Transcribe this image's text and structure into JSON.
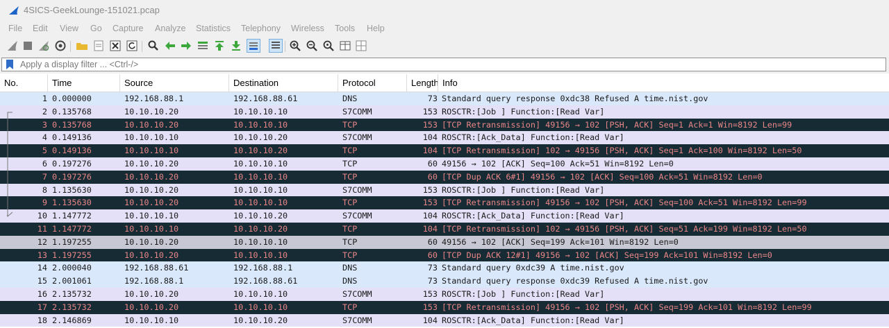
{
  "window": {
    "title": "4SICS-GeekLounge-151021.pcap",
    "logo_icon": "wireshark-fin-icon"
  },
  "menu": [
    "File",
    "Edit",
    "View",
    "Go",
    "Capture",
    "Analyze",
    "Statistics",
    "Telephony",
    "Wireless",
    "Tools",
    "Help"
  ],
  "filter": {
    "placeholder": "Apply a display filter ... <Ctrl-/>",
    "value": ""
  },
  "columns": [
    "No.",
    "Time",
    "Source",
    "Destination",
    "Protocol",
    "Length",
    "Info"
  ],
  "packets": [
    {
      "no": "1",
      "time": "0.000000",
      "src": "192.168.88.1",
      "dst": "192.168.88.61",
      "proto": "DNS",
      "len": "73",
      "info": "Standard query response 0xdc38 Refused A time.nist.gov",
      "style": "light"
    },
    {
      "no": "2",
      "time": "0.135768",
      "src": "10.10.10.20",
      "dst": "10.10.10.10",
      "proto": "S7COMM",
      "len": "153",
      "info": "ROSCTR:[Job     ] Function:[Read Var]",
      "style": "lilac"
    },
    {
      "no": "3",
      "time": "0.135768",
      "src": "10.10.10.20",
      "dst": "10.10.10.10",
      "proto": "TCP",
      "len": "153",
      "info": "[TCP Retransmission] 49156 → 102 [PSH, ACK] Seq=1 Ack=1 Win=8192 Len=99",
      "style": "dark"
    },
    {
      "no": "4",
      "time": "0.149136",
      "src": "10.10.10.10",
      "dst": "10.10.10.20",
      "proto": "S7COMM",
      "len": "104",
      "info": "ROSCTR:[Ack_Data] Function:[Read Var]",
      "style": "lilac"
    },
    {
      "no": "5",
      "time": "0.149136",
      "src": "10.10.10.10",
      "dst": "10.10.10.20",
      "proto": "TCP",
      "len": "104",
      "info": "[TCP Retransmission] 102 → 49156 [PSH, ACK] Seq=1 Ack=100 Win=8192 Len=50",
      "style": "dark"
    },
    {
      "no": "6",
      "time": "0.197276",
      "src": "10.10.10.20",
      "dst": "10.10.10.10",
      "proto": "TCP",
      "len": "60",
      "info": "49156 → 102 [ACK] Seq=100 Ack=51 Win=8192 Len=0",
      "style": "lilac"
    },
    {
      "no": "7",
      "time": "0.197276",
      "src": "10.10.10.20",
      "dst": "10.10.10.10",
      "proto": "TCP",
      "len": "60",
      "info": "[TCP Dup ACK 6#1] 49156 → 102 [ACK] Seq=100 Ack=51 Win=8192 Len=0",
      "style": "dark"
    },
    {
      "no": "8",
      "time": "1.135630",
      "src": "10.10.10.20",
      "dst": "10.10.10.10",
      "proto": "S7COMM",
      "len": "153",
      "info": "ROSCTR:[Job     ] Function:[Read Var]",
      "style": "lilac"
    },
    {
      "no": "9",
      "time": "1.135630",
      "src": "10.10.10.20",
      "dst": "10.10.10.10",
      "proto": "TCP",
      "len": "153",
      "info": "[TCP Retransmission] 49156 → 102 [PSH, ACK] Seq=100 Ack=51 Win=8192 Len=99",
      "style": "dark"
    },
    {
      "no": "10",
      "time": "1.147772",
      "src": "10.10.10.10",
      "dst": "10.10.10.20",
      "proto": "S7COMM",
      "len": "104",
      "info": "ROSCTR:[Ack_Data] Function:[Read Var]",
      "style": "lilac"
    },
    {
      "no": "11",
      "time": "1.147772",
      "src": "10.10.10.10",
      "dst": "10.10.10.20",
      "proto": "TCP",
      "len": "104",
      "info": "[TCP Retransmission] 102 → 49156 [PSH, ACK] Seq=51 Ack=199 Win=8192 Len=50",
      "style": "dark"
    },
    {
      "no": "12",
      "time": "1.197255",
      "src": "10.10.10.20",
      "dst": "10.10.10.10",
      "proto": "TCP",
      "len": "60",
      "info": "49156 → 102 [ACK] Seq=199 Ack=101 Win=8192 Len=0",
      "style": "selected"
    },
    {
      "no": "13",
      "time": "1.197255",
      "src": "10.10.10.20",
      "dst": "10.10.10.10",
      "proto": "TCP",
      "len": "60",
      "info": "[TCP Dup ACK 12#1] 49156 → 102 [ACK] Seq=199 Ack=101 Win=8192 Len=0",
      "style": "dark"
    },
    {
      "no": "14",
      "time": "2.000040",
      "src": "192.168.88.61",
      "dst": "192.168.88.1",
      "proto": "DNS",
      "len": "73",
      "info": "Standard query 0xdc39 A time.nist.gov",
      "style": "light"
    },
    {
      "no": "15",
      "time": "2.001061",
      "src": "192.168.88.1",
      "dst": "192.168.88.61",
      "proto": "DNS",
      "len": "73",
      "info": "Standard query response 0xdc39 Refused A time.nist.gov",
      "style": "light"
    },
    {
      "no": "16",
      "time": "2.135732",
      "src": "10.10.10.20",
      "dst": "10.10.10.10",
      "proto": "S7COMM",
      "len": "153",
      "info": "ROSCTR:[Job     ] Function:[Read Var]",
      "style": "lilac"
    },
    {
      "no": "17",
      "time": "2.135732",
      "src": "10.10.10.20",
      "dst": "10.10.10.10",
      "proto": "TCP",
      "len": "153",
      "info": "[TCP Retransmission] 49156 → 102 [PSH, ACK] Seq=199 Ack=101 Win=8192 Len=99",
      "style": "dark"
    },
    {
      "no": "18",
      "time": "2.146869",
      "src": "10.10.10.10",
      "dst": "10.10.10.20",
      "proto": "S7COMM",
      "len": "104",
      "info": "ROSCTR:[Ack_Data] Function:[Read Var]",
      "style": "lilac"
    }
  ],
  "colors": {
    "dns_row": "#dae8fc",
    "s7comm_row": "#e4e0f7",
    "bad_tcp_bg": "#172b35",
    "bad_tcp_fg": "#e98686",
    "selected_row": "#c8c8d4"
  }
}
